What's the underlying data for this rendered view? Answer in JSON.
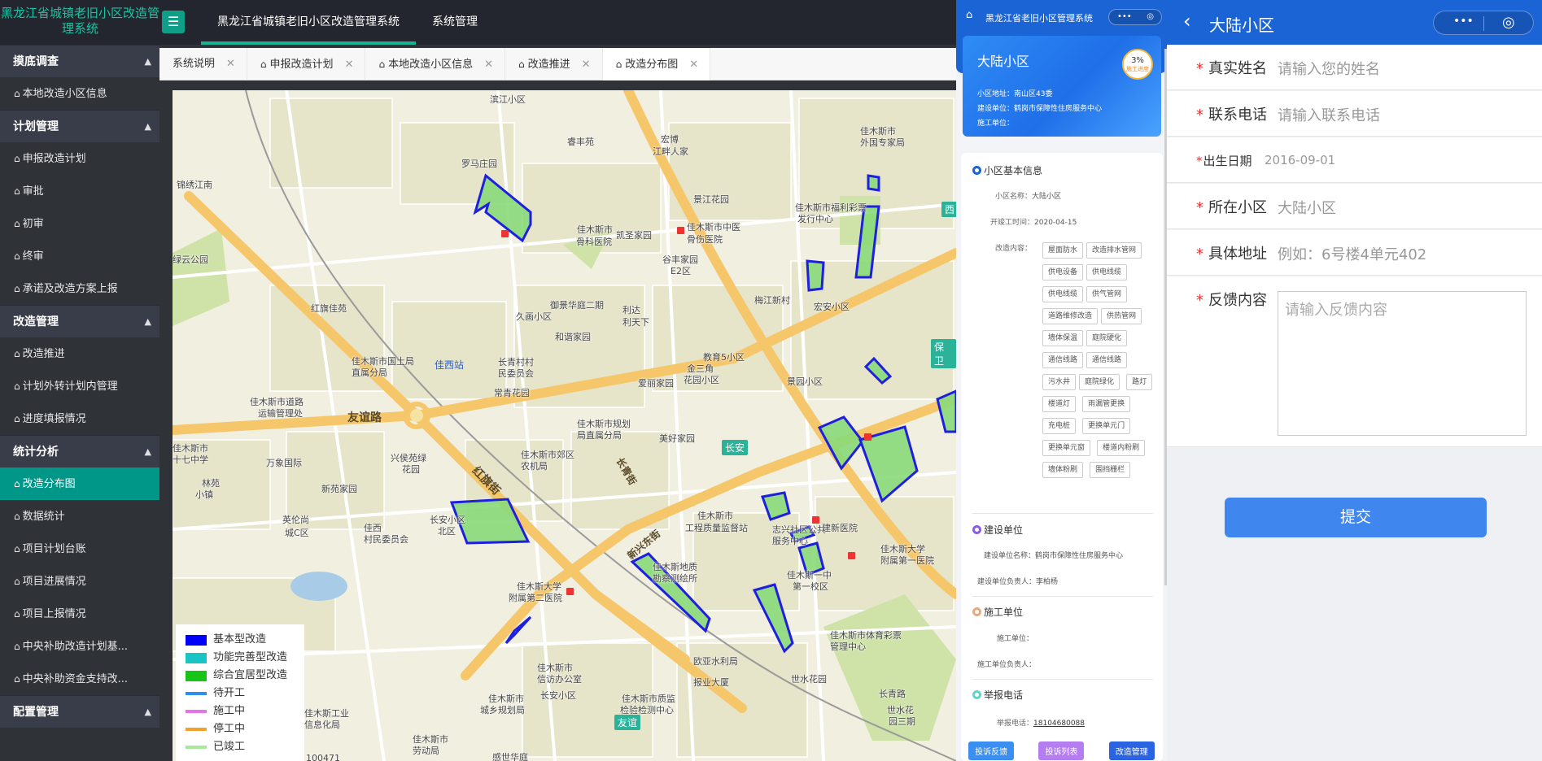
{
  "header": {
    "logo": "黑龙江省城镇老旧小区改造管理系统",
    "nav": [
      "黑龙江省城镇老旧小区改造管理系统",
      "系统管理"
    ]
  },
  "sidebar": {
    "groups": [
      {
        "label": "摸底调查",
        "items": [
          "本地改造小区信息"
        ]
      },
      {
        "label": "计划管理",
        "items": [
          "申报改造计划",
          "审批",
          "初审",
          "终审",
          "承诺及改造方案上报"
        ]
      },
      {
        "label": "改造管理",
        "items": [
          "改造推进",
          "计划外转计划内管理",
          "进度填报情况"
        ]
      },
      {
        "label": "统计分析",
        "items": [
          "改造分布图",
          "数据统计",
          "项目计划台账",
          "项目进展情况",
          "项目上报情况",
          "中央补助改造计划基...",
          "中央补助资金支持改..."
        ]
      },
      {
        "label": "配置管理",
        "items": []
      }
    ],
    "active_item": "改造分布图"
  },
  "tabs": [
    "系统说明",
    "申报改造计划",
    "本地改造小区信息",
    "改造推进",
    "改造分布图"
  ],
  "active_tab": "改造分布图",
  "map": {
    "labels": [
      "滨江小区",
      "睿丰苑",
      "宏博",
      "江畔人家",
      "罗马庄园",
      "锦绣江南",
      "景江花园",
      "佳木斯市",
      "骨科医院",
      "凯圣家园",
      "佳木斯市中医",
      "骨伤医院",
      "谷丰家园",
      "E2区",
      "佳木斯市福利彩票",
      "发行中心",
      "佳木斯市",
      "外国专家局",
      "绿云公园",
      "御景华庭二期",
      "利达",
      "利天下",
      "梅江新村",
      "宏安小区",
      "红旗佳苑",
      "久画小区",
      "和谐家园",
      "佳木斯市国土局",
      "直属分局",
      "长青村村",
      "民委员会",
      "教育5小区",
      "金三角",
      "花园小区",
      "爱丽家园",
      "景园小区",
      "常青花园",
      "佳木斯市道路",
      "运输管理处",
      "佳木斯市规划",
      "局直属分局",
      "美好家园",
      "佳木斯市",
      "十七中学",
      "万象国际",
      "兴侯苑绿",
      "花园",
      "佳木斯市郊区",
      "农机局",
      "林苑",
      "小镇",
      "新苑家园",
      "英伦尚",
      "城C区",
      "佳西",
      "村民委员会",
      "长安小区",
      "北区",
      "佳木斯市",
      "工程质量监督站",
      "志兴社区公共",
      "服务中心",
      "建新医院",
      "佳木斯大学",
      "附属第一医院",
      "佳木斯地质",
      "勘察测绘所",
      "佳木斯大学",
      "附属第二医院",
      "佳木斯一中",
      "第一校区",
      "佳木斯市体育彩票",
      "管理中心",
      "欧亚水利局",
      "佳木斯市",
      "信访办公室",
      "长安小区",
      "报业大厦",
      "世水花园",
      "佳木斯工业",
      "信息化局",
      "佳木斯市",
      "城乡规划局",
      "佳木斯市质监",
      "检验检测中心",
      "长青路",
      "世水花",
      "园三期",
      "佳木斯市",
      "劳动局",
      "感世华庭",
      "100471"
    ],
    "roads": [
      "友谊路",
      "红旗街",
      "长青街",
      "新兴东街"
    ],
    "stations": [
      "佳西站",
      "长安",
      "保卫",
      "友谊",
      "西"
    ],
    "legend": [
      {
        "label": "基本型改造",
        "color": "#0000ff",
        "kind": "box"
      },
      {
        "label": "功能完善型改造",
        "color": "#19c4c4",
        "kind": "box"
      },
      {
        "label": "综合宜居型改造",
        "color": "#19c419",
        "kind": "box"
      },
      {
        "label": "待开工",
        "color": "#2a8ff0",
        "kind": "line"
      },
      {
        "label": "施工中",
        "color": "#e873e8",
        "kind": "line"
      },
      {
        "label": "停工中",
        "color": "#f2a12b",
        "kind": "line"
      },
      {
        "label": "已竣工",
        "color": "#a8e89a",
        "kind": "line"
      }
    ]
  },
  "mini": {
    "title": "黑龙江省老旧小区管理系统",
    "card": {
      "name": "大陆小区",
      "progress": "3%",
      "progress_label": "施工进度",
      "address": "小区地址：南山区43委",
      "builder": "建设单位：鹤岗市保障性住房服务中心",
      "constructor": "施工单位："
    },
    "basic": {
      "heading": "小区基本信息",
      "name_k": "小区名称：",
      "name_v": "大陆小区",
      "start_k": "开竣工时间：",
      "start_v": "2020-04-15",
      "content_k": "改造内容：",
      "tags": [
        "屋面防水",
        "改造排水管网",
        "供电设备",
        "供电线缆",
        "供电线缆",
        "供气管网",
        "道路维修改造",
        "供热管网",
        "墙体保温",
        "庭院硬化",
        "通信线路",
        "通信线路",
        "污水井",
        "庭院绿化",
        "路灯",
        "楼道灯",
        "雨漏管更换",
        "充电桩",
        "更换单元门",
        "更换单元窗",
        "楼道内粉刷",
        "墙体粉刷",
        "围挡栅栏"
      ]
    },
    "builder": {
      "heading": "建设单位",
      "name": "建设单位名称：鹤岗市保障性住房服务中心",
      "owner": "建设单位负责人：李柏杨"
    },
    "constr": {
      "heading": "施工单位",
      "name": "施工单位：",
      "owner": "施工单位负责人："
    },
    "report": {
      "heading": "举报电话",
      "phone_k": "举报电话：",
      "phone": "18104680088"
    },
    "buttons": [
      "投诉反馈",
      "投诉列表",
      "改造管理"
    ]
  },
  "form": {
    "title": "大陆小区",
    "fields": [
      {
        "label": "真实姓名",
        "value": "请输入您的姓名",
        "required": true
      },
      {
        "label": "联系电话",
        "value": "请输入联系电话",
        "required": true
      },
      {
        "label": "出生日期",
        "value": "2016-09-01",
        "required": true
      },
      {
        "label": "所在小区",
        "value": "大陆小区",
        "required": true
      },
      {
        "label": "具体地址",
        "value": "例如：6号楼4单元402",
        "required": true
      },
      {
        "label": "反馈内容",
        "value": "请输入反馈内容",
        "required": true
      }
    ],
    "submit": "提交"
  }
}
